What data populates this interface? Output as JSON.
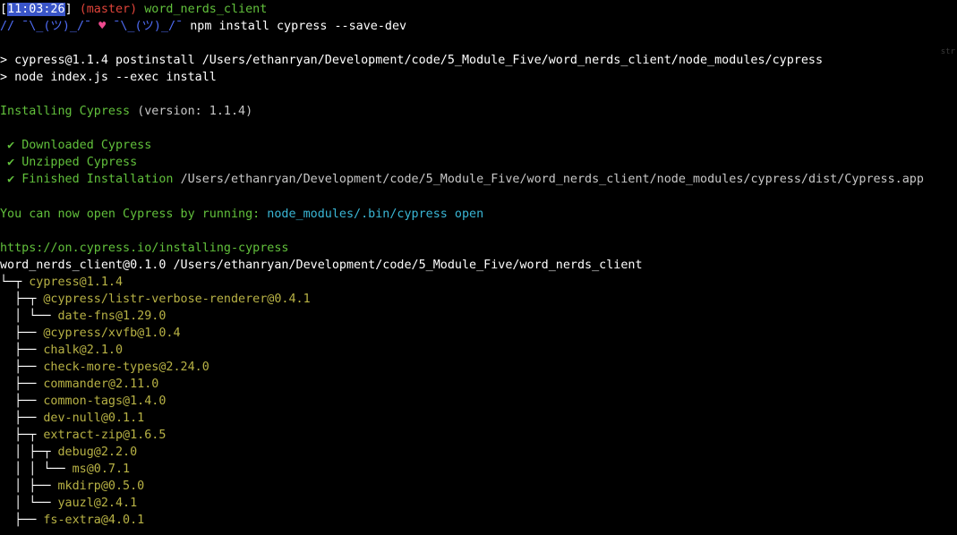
{
  "colors": {
    "background": "#000000",
    "timestamp_bg": "#3a55c8",
    "branch": "#e0443a",
    "dir": "#62c13c",
    "prompt_symbol": "#4f6cf5",
    "heart": "#ef4a8f",
    "success": "#62c13c",
    "tree_pkg": "#b8b245",
    "command_link": "#3ab7d6"
  },
  "ghost_text": "str",
  "prompt": {
    "open_bracket": "[",
    "timestamp": "11:03:26",
    "close_bracket": "]",
    "branch": "(master)",
    "directory": "word_nerds_client",
    "symbol_left": "// ¯\\_(ツ)_/¯",
    "heart": "♥",
    "symbol_right": "¯\\_(ツ)_/¯",
    "command": "npm install cypress --save-dev"
  },
  "output": {
    "postinstall_line": "> cypress@1.1.4 postinstall /Users/ethanryan/Development/code/5_Module_Five/word_nerds_client/node_modules/cypress",
    "exec_line": "> node index.js --exec install",
    "installing_label": "Installing Cypress",
    "installing_version": "(version: 1.1.4)",
    "check": "✔",
    "downloaded": "Downloaded Cypress",
    "unzipped": "Unzipped Cypress",
    "finished": "Finished Installation",
    "finished_path": "/Users/ethanryan/Development/code/5_Module_Five/word_nerds_client/node_modules/cypress/dist/Cypress.app",
    "open_text": "You can now open Cypress by running:",
    "open_command": "node_modules/.bin/cypress open",
    "docs_url": "https://on.cypress.io/installing-cypress",
    "root_package": "word_nerds_client@0.1.0 /Users/ethanryan/Development/code/5_Module_Five/word_nerds_client"
  },
  "tree": [
    {
      "prefix": "└─┬ ",
      "pkg": "cypress@1.1.4"
    },
    {
      "prefix": "  ├─┬ ",
      "pkg": "@cypress/listr-verbose-renderer@0.4.1"
    },
    {
      "prefix": "  │ └── ",
      "pkg": "date-fns@1.29.0"
    },
    {
      "prefix": "  ├── ",
      "pkg": "@cypress/xvfb@1.0.4"
    },
    {
      "prefix": "  ├── ",
      "pkg": "chalk@2.1.0"
    },
    {
      "prefix": "  ├── ",
      "pkg": "check-more-types@2.24.0"
    },
    {
      "prefix": "  ├── ",
      "pkg": "commander@2.11.0"
    },
    {
      "prefix": "  ├── ",
      "pkg": "common-tags@1.4.0"
    },
    {
      "prefix": "  ├── ",
      "pkg": "dev-null@0.1.1"
    },
    {
      "prefix": "  ├─┬ ",
      "pkg": "extract-zip@1.6.5"
    },
    {
      "prefix": "  │ ├─┬ ",
      "pkg": "debug@2.2.0"
    },
    {
      "prefix": "  │ │ └── ",
      "pkg": "ms@0.7.1"
    },
    {
      "prefix": "  │ ├── ",
      "pkg": "mkdirp@0.5.0"
    },
    {
      "prefix": "  │ └── ",
      "pkg": "yauzl@2.4.1"
    },
    {
      "prefix": "  ├── ",
      "pkg": "fs-extra@4.0.1"
    }
  ]
}
